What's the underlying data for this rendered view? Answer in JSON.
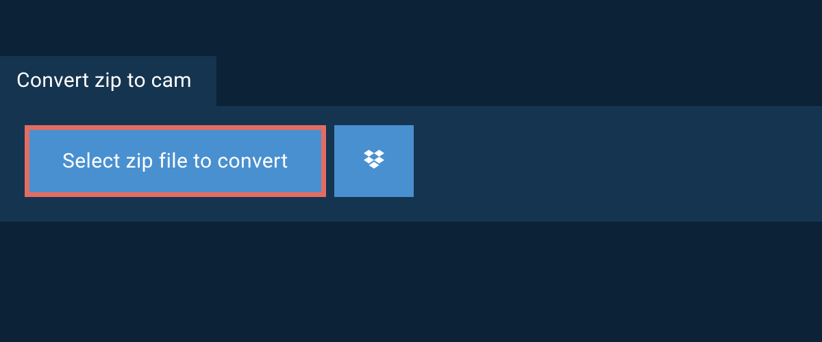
{
  "tab": {
    "title": "Convert zip to cam"
  },
  "buttons": {
    "select_label": "Select zip file to convert"
  },
  "colors": {
    "background": "#0c2237",
    "panel": "#153450",
    "button_bg": "#4990d0",
    "outline": "#e36c63",
    "text": "#ffffff"
  }
}
